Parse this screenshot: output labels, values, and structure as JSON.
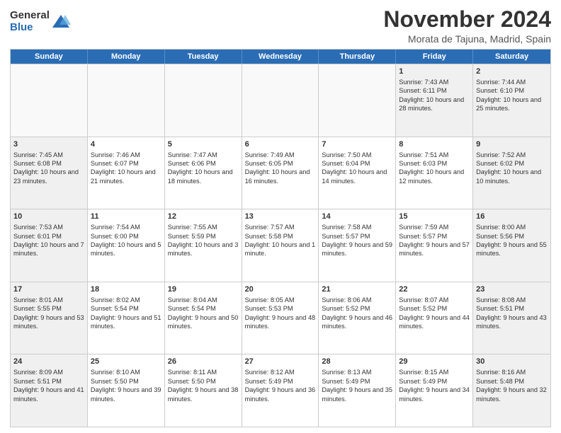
{
  "logo": {
    "general": "General",
    "blue": "Blue"
  },
  "header": {
    "month": "November 2024",
    "location": "Morata de Tajuna, Madrid, Spain"
  },
  "days": [
    "Sunday",
    "Monday",
    "Tuesday",
    "Wednesday",
    "Thursday",
    "Friday",
    "Saturday"
  ],
  "rows": [
    [
      {
        "day": "",
        "empty": true
      },
      {
        "day": "",
        "empty": true
      },
      {
        "day": "",
        "empty": true
      },
      {
        "day": "",
        "empty": true
      },
      {
        "day": "",
        "empty": true
      },
      {
        "day": "1",
        "sunrise": "7:43 AM",
        "sunset": "6:11 PM",
        "daylight": "10 hours and 28 minutes."
      },
      {
        "day": "2",
        "sunrise": "7:44 AM",
        "sunset": "6:10 PM",
        "daylight": "10 hours and 25 minutes."
      }
    ],
    [
      {
        "day": "3",
        "sunrise": "7:45 AM",
        "sunset": "6:08 PM",
        "daylight": "10 hours and 23 minutes."
      },
      {
        "day": "4",
        "sunrise": "7:46 AM",
        "sunset": "6:07 PM",
        "daylight": "10 hours and 21 minutes."
      },
      {
        "day": "5",
        "sunrise": "7:47 AM",
        "sunset": "6:06 PM",
        "daylight": "10 hours and 18 minutes."
      },
      {
        "day": "6",
        "sunrise": "7:49 AM",
        "sunset": "6:05 PM",
        "daylight": "10 hours and 16 minutes."
      },
      {
        "day": "7",
        "sunrise": "7:50 AM",
        "sunset": "6:04 PM",
        "daylight": "10 hours and 14 minutes."
      },
      {
        "day": "8",
        "sunrise": "7:51 AM",
        "sunset": "6:03 PM",
        "daylight": "10 hours and 12 minutes."
      },
      {
        "day": "9",
        "sunrise": "7:52 AM",
        "sunset": "6:02 PM",
        "daylight": "10 hours and 10 minutes."
      }
    ],
    [
      {
        "day": "10",
        "sunrise": "7:53 AM",
        "sunset": "6:01 PM",
        "daylight": "10 hours and 7 minutes."
      },
      {
        "day": "11",
        "sunrise": "7:54 AM",
        "sunset": "6:00 PM",
        "daylight": "10 hours and 5 minutes."
      },
      {
        "day": "12",
        "sunrise": "7:55 AM",
        "sunset": "5:59 PM",
        "daylight": "10 hours and 3 minutes."
      },
      {
        "day": "13",
        "sunrise": "7:57 AM",
        "sunset": "5:58 PM",
        "daylight": "10 hours and 1 minute."
      },
      {
        "day": "14",
        "sunrise": "7:58 AM",
        "sunset": "5:57 PM",
        "daylight": "9 hours and 59 minutes."
      },
      {
        "day": "15",
        "sunrise": "7:59 AM",
        "sunset": "5:57 PM",
        "daylight": "9 hours and 57 minutes."
      },
      {
        "day": "16",
        "sunrise": "8:00 AM",
        "sunset": "5:56 PM",
        "daylight": "9 hours and 55 minutes."
      }
    ],
    [
      {
        "day": "17",
        "sunrise": "8:01 AM",
        "sunset": "5:55 PM",
        "daylight": "9 hours and 53 minutes."
      },
      {
        "day": "18",
        "sunrise": "8:02 AM",
        "sunset": "5:54 PM",
        "daylight": "9 hours and 51 minutes."
      },
      {
        "day": "19",
        "sunrise": "8:04 AM",
        "sunset": "5:54 PM",
        "daylight": "9 hours and 50 minutes."
      },
      {
        "day": "20",
        "sunrise": "8:05 AM",
        "sunset": "5:53 PM",
        "daylight": "9 hours and 48 minutes."
      },
      {
        "day": "21",
        "sunrise": "8:06 AM",
        "sunset": "5:52 PM",
        "daylight": "9 hours and 46 minutes."
      },
      {
        "day": "22",
        "sunrise": "8:07 AM",
        "sunset": "5:52 PM",
        "daylight": "9 hours and 44 minutes."
      },
      {
        "day": "23",
        "sunrise": "8:08 AM",
        "sunset": "5:51 PM",
        "daylight": "9 hours and 43 minutes."
      }
    ],
    [
      {
        "day": "24",
        "sunrise": "8:09 AM",
        "sunset": "5:51 PM",
        "daylight": "9 hours and 41 minutes."
      },
      {
        "day": "25",
        "sunrise": "8:10 AM",
        "sunset": "5:50 PM",
        "daylight": "9 hours and 39 minutes."
      },
      {
        "day": "26",
        "sunrise": "8:11 AM",
        "sunset": "5:50 PM",
        "daylight": "9 hours and 38 minutes."
      },
      {
        "day": "27",
        "sunrise": "8:12 AM",
        "sunset": "5:49 PM",
        "daylight": "9 hours and 36 minutes."
      },
      {
        "day": "28",
        "sunrise": "8:13 AM",
        "sunset": "5:49 PM",
        "daylight": "9 hours and 35 minutes."
      },
      {
        "day": "29",
        "sunrise": "8:15 AM",
        "sunset": "5:49 PM",
        "daylight": "9 hours and 34 minutes."
      },
      {
        "day": "30",
        "sunrise": "8:16 AM",
        "sunset": "5:48 PM",
        "daylight": "9 hours and 32 minutes."
      }
    ]
  ]
}
